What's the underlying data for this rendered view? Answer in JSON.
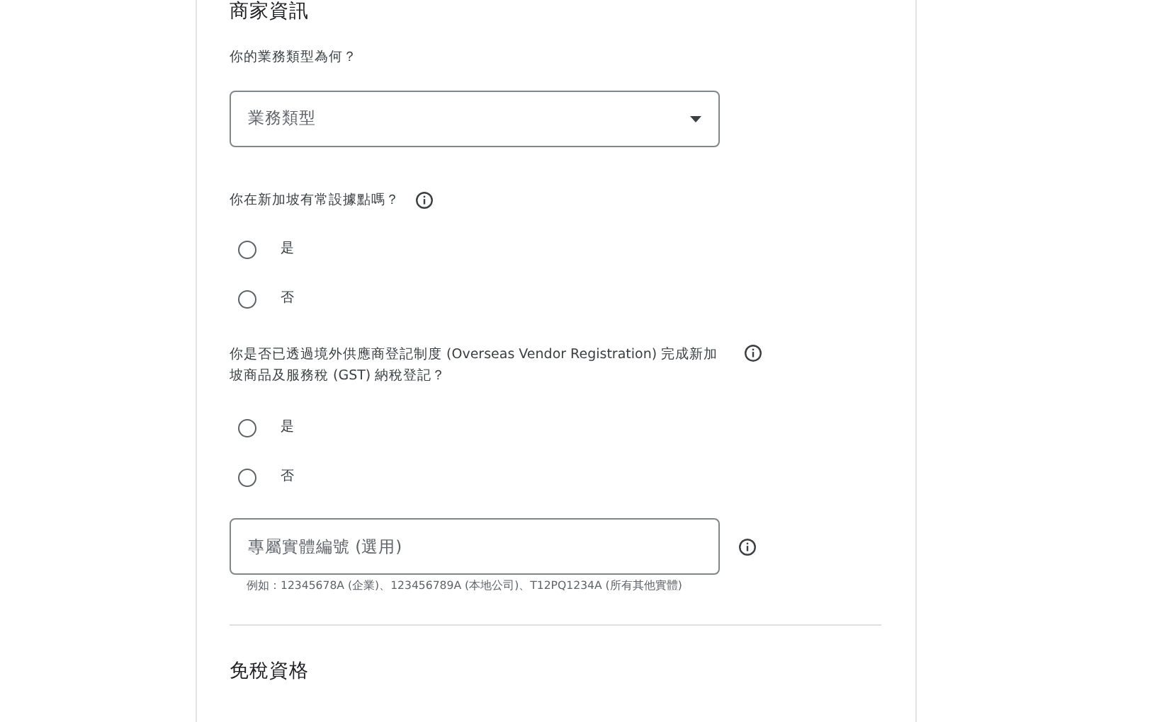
{
  "section_title": "商家資訊",
  "business_type": {
    "question": "你的業務類型為何？",
    "placeholder": "業務類型"
  },
  "establishment": {
    "question": "你在新加坡有常設據點嗎？",
    "options": [
      {
        "label": "是",
        "selected": false
      },
      {
        "label": "否",
        "selected": false
      }
    ]
  },
  "gst": {
    "question": "你是否已透過境外供應商登記制度 (Overseas Vendor Registration) 完成新加坡商品及服務稅 (GST) 納稅登記？",
    "options": [
      {
        "label": "是",
        "selected": false
      },
      {
        "label": "否",
        "selected": false
      }
    ]
  },
  "entity_number": {
    "placeholder": "專屬實體編號 (選用)",
    "hint": "例如：12345678A (企業)、123456789A (本地公司)、T12PQ1234A (所有其他實體)"
  },
  "next_section_title": "免稅資格"
}
